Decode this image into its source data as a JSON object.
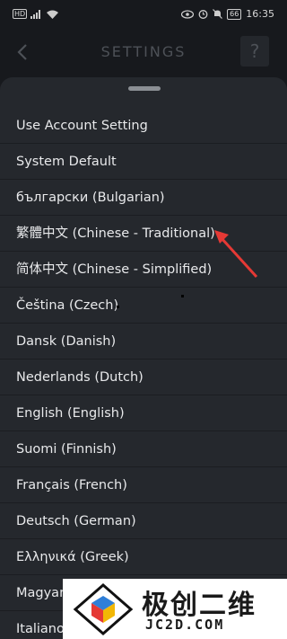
{
  "status_bar": {
    "time": "16:35",
    "battery": "66",
    "network": "HD"
  },
  "header": {
    "title": "SETTINGS",
    "back_icon": "chevron-left-icon",
    "help_label": "?"
  },
  "languages": [
    "Use Account Setting",
    "System Default",
    "български (Bulgarian)",
    "繁體中文 (Chinese - Traditional)",
    "简体中文 (Chinese - Simplified)",
    "Čeština (Czech)",
    "Dansk (Danish)",
    "Nederlands (Dutch)",
    "English (English)",
    "Suomi (Finnish)",
    "Français (French)",
    "Deutsch (German)",
    "Ελληνικά (Greek)",
    "Magyar",
    "Italiano"
  ],
  "watermark": {
    "brand_cn": "极创二维",
    "brand_en": "JC2D.COM"
  },
  "colors": {
    "background": "#17191d",
    "sheet": "#25282d",
    "arrow": "#e53935"
  }
}
